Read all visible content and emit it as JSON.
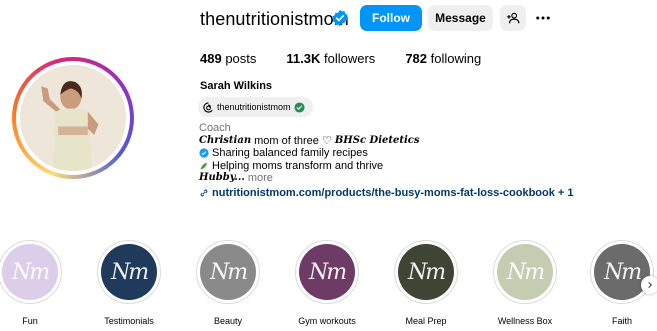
{
  "profile": {
    "username": "thenutritionistmom",
    "verified_icon": "verified-badge-icon",
    "full_name": "Sarah Wilkins",
    "threads_handle": "thenutritionistmom"
  },
  "actions": {
    "follow_label": "Follow",
    "message_label": "Message",
    "suggest_icon": "add-person-icon",
    "more_icon": "more-options-icon"
  },
  "stats": {
    "posts_count": "489",
    "posts_label": "posts",
    "followers_count": "11.3K",
    "followers_label": "followers",
    "following_count": "782",
    "following_label": "following"
  },
  "bio": {
    "category": "Coach",
    "line1_a": "Christian",
    "line1_b": "mom of three ♡",
    "line1_c": "BHSc Dietetics",
    "line2": "Sharing balanced family recipes",
    "line3": "Helping moms transform and thrive",
    "line4_a": "Hubby...",
    "line4_more": "more",
    "link": "nutritionistmom.com/products/the-busy-moms-fat-loss-cookbook + 1"
  },
  "highlights": [
    {
      "label": "Fun",
      "color": "#dccde8"
    },
    {
      "label": "Testimonials",
      "color": "#1f3a5b"
    },
    {
      "label": "Beauty",
      "color": "#8a8a8a"
    },
    {
      "label": "Gym workouts",
      "color": "#6e3b66"
    },
    {
      "label": "Meal Prep",
      "color": "#3e4535"
    },
    {
      "label": "Wellness Box",
      "color": "#c5ccb1"
    },
    {
      "label": "Faith",
      "color": "#6b6b6b"
    }
  ],
  "colors": {
    "accent": "#0095f6",
    "verified": "#0095f6",
    "link": "#00376b"
  }
}
